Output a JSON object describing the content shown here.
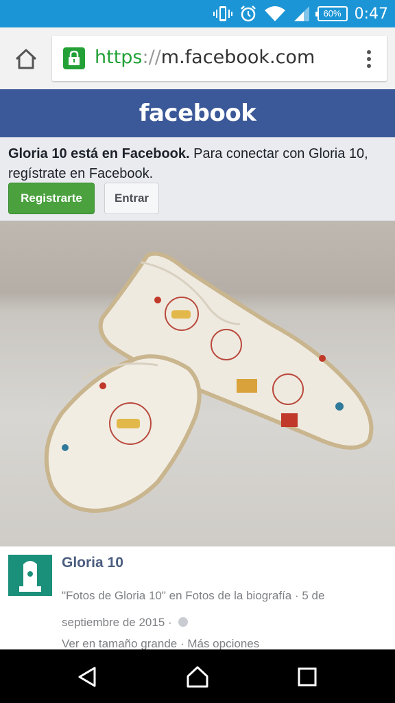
{
  "status_bar": {
    "battery": "60%",
    "time": "0:47",
    "icons": [
      "vibrate-icon",
      "alarm-icon",
      "wifi-icon",
      "signal-icon",
      "battery-icon"
    ]
  },
  "browser": {
    "url_scheme": "https",
    "url_separator": "://",
    "url_host": "m.facebook.com",
    "icons": [
      "home-icon",
      "lock-icon",
      "overflow-menu-icon"
    ]
  },
  "facebook": {
    "logo": "facebook",
    "brand_color": "#3b5998"
  },
  "notice": {
    "bold": "Gloria 10 está en Facebook.",
    "text": " Para conectar con Gloria 10, regístrate en Facebook.",
    "register_label": "Registrarte",
    "login_label": "Entrar"
  },
  "post": {
    "author": "Gloria 10",
    "caption_line1": "\"Fotos de Gloria 10\" en Fotos de la biografía · 5 de",
    "caption_line2": "septiembre de 2015 ·",
    "links": "Ver en tamaño grande · Más opciones"
  },
  "navbar": {
    "icons": [
      "back-icon",
      "home-nav-icon",
      "recents-icon"
    ]
  }
}
